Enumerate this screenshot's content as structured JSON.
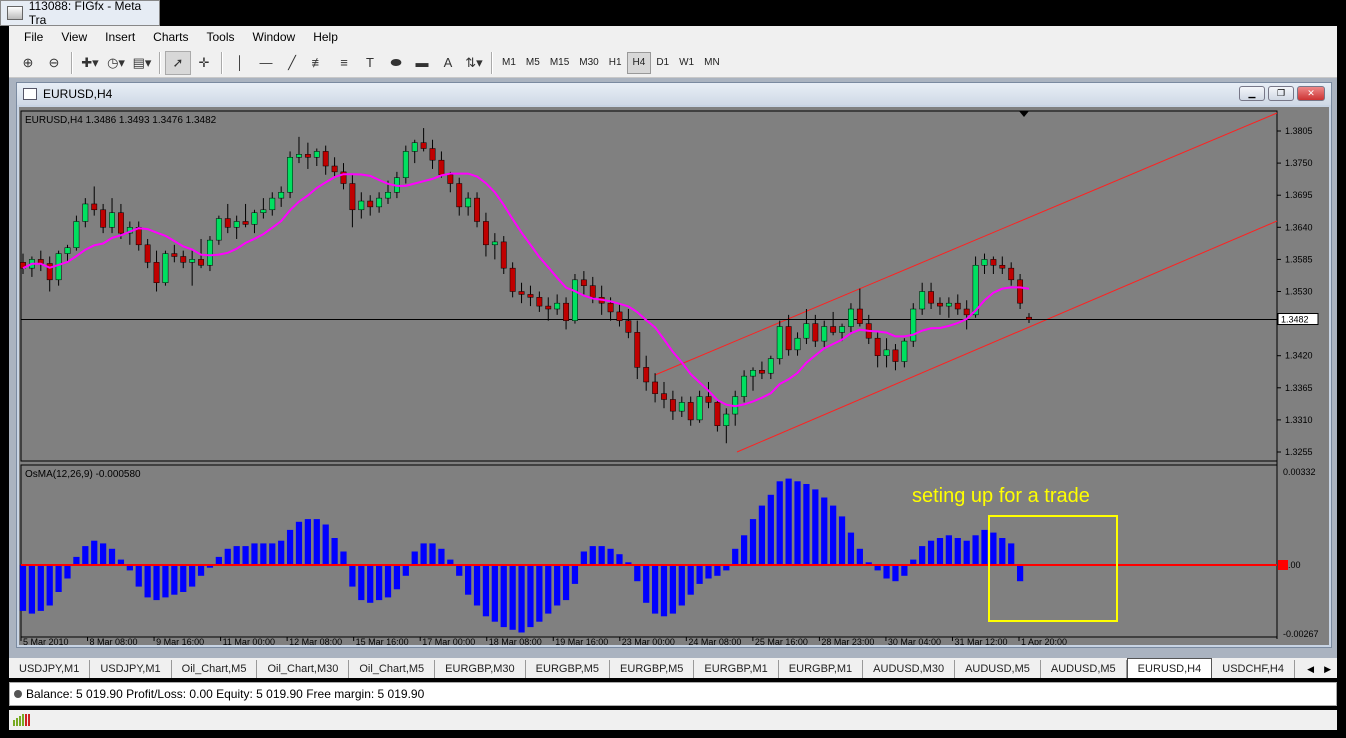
{
  "window": {
    "title": "113088: FIGfx - Meta Tra"
  },
  "menu": [
    "File",
    "View",
    "Insert",
    "Charts",
    "Tools",
    "Window",
    "Help"
  ],
  "toolbar": {
    "timeframes": [
      "M1",
      "M5",
      "M15",
      "M30",
      "H1",
      "H4",
      "D1",
      "W1",
      "MN"
    ],
    "active_timeframe": "H4"
  },
  "chart_window": {
    "title": "EURUSD,H4",
    "info": "EURUSD,H4  1.3486 1.3493 1.3476 1.3482",
    "current_price": "1.3482",
    "price_ticks": [
      "1.3805",
      "1.3750",
      "1.3695",
      "1.3640",
      "1.3585",
      "1.3530",
      "1.3420",
      "1.3365",
      "1.3310",
      "1.3255"
    ],
    "indicator_label": "OsMA(12,26,9) -0.000580",
    "indicator_ticks": [
      "0.00332",
      "0.00",
      "-0.00267"
    ],
    "annotation": "seting up for a trade",
    "time_labels": [
      "5 Mar 2010",
      "8 Mar 08:00",
      "9 Mar 16:00",
      "11 Mar 00:00",
      "12 Mar 08:00",
      "15 Mar 16:00",
      "17 Mar 00:00",
      "18 Mar 08:00",
      "19 Mar 16:00",
      "23 Mar 00:00",
      "24 Mar 08:00",
      "25 Mar 16:00",
      "28 Mar 23:00",
      "30 Mar 04:00",
      "31 Mar 12:00",
      "1 Apr 20:00"
    ]
  },
  "tabs": [
    "USDJPY,M1",
    "USDJPY,M1",
    "Oil_Chart,M5",
    "Oil_Chart,M30",
    "Oil_Chart,M5",
    "EURGBP,M30",
    "EURGBP,M5",
    "EURGBP,M5",
    "EURGBP,M1",
    "EURGBP,M1",
    "AUDUSD,M30",
    "AUDUSD,M5",
    "AUDUSD,M5",
    "EURUSD,H4",
    "USDCHF,H4"
  ],
  "active_tab": "EURUSD,H4",
  "terminal": {
    "text": "Balance: 5 019.90  Profit/Loss: 0.00  Equity: 5 019.90  Free margin: 5 019.90"
  },
  "colors": {
    "chart_bg": "#808080",
    "bull": "#00e060",
    "bear": "#c00000",
    "ma": "#ff00ff",
    "osma": "#0000ff",
    "channel": "#ff0000",
    "annotation": "#ffff00"
  },
  "chart_data": {
    "type": "candlestick",
    "symbol": "EURUSD",
    "timeframe": "H4",
    "ylim": [
      1.3255,
      1.3805
    ],
    "current": 1.3482,
    "candles": [
      [
        1.358,
        1.3595,
        1.356,
        1.357
      ],
      [
        1.357,
        1.359,
        1.3555,
        1.3585
      ],
      [
        1.3585,
        1.36,
        1.3565,
        1.3578
      ],
      [
        1.3578,
        1.359,
        1.353,
        1.355
      ],
      [
        1.355,
        1.36,
        1.354,
        1.3595
      ],
      [
        1.3595,
        1.361,
        1.358,
        1.3605
      ],
      [
        1.3605,
        1.366,
        1.36,
        1.365
      ],
      [
        1.365,
        1.369,
        1.364,
        1.368
      ],
      [
        1.368,
        1.371,
        1.366,
        1.367
      ],
      [
        1.367,
        1.368,
        1.363,
        1.364
      ],
      [
        1.364,
        1.369,
        1.363,
        1.3665
      ],
      [
        1.3665,
        1.368,
        1.362,
        1.363
      ],
      [
        1.363,
        1.365,
        1.361,
        1.364
      ],
      [
        1.364,
        1.365,
        1.36,
        1.361
      ],
      [
        1.361,
        1.362,
        1.357,
        1.358
      ],
      [
        1.358,
        1.36,
        1.353,
        1.3545
      ],
      [
        1.3545,
        1.36,
        1.354,
        1.3595
      ],
      [
        1.3595,
        1.361,
        1.358,
        1.359
      ],
      [
        1.359,
        1.36,
        1.357,
        1.358
      ],
      [
        1.358,
        1.36,
        1.354,
        1.3585
      ],
      [
        1.3585,
        1.362,
        1.357,
        1.3575
      ],
      [
        1.3575,
        1.3625,
        1.3565,
        1.3618
      ],
      [
        1.3618,
        1.366,
        1.361,
        1.3655
      ],
      [
        1.3655,
        1.368,
        1.363,
        1.364
      ],
      [
        1.364,
        1.366,
        1.362,
        1.365
      ],
      [
        1.365,
        1.368,
        1.364,
        1.3645
      ],
      [
        1.3645,
        1.367,
        1.363,
        1.3665
      ],
      [
        1.3665,
        1.369,
        1.3655,
        1.367
      ],
      [
        1.367,
        1.37,
        1.366,
        1.369
      ],
      [
        1.369,
        1.371,
        1.3675,
        1.37
      ],
      [
        1.37,
        1.377,
        1.369,
        1.376
      ],
      [
        1.376,
        1.3795,
        1.375,
        1.3765
      ],
      [
        1.3765,
        1.3785,
        1.374,
        1.376
      ],
      [
        1.376,
        1.3775,
        1.3745,
        1.377
      ],
      [
        1.377,
        1.378,
        1.373,
        1.3745
      ],
      [
        1.3745,
        1.376,
        1.3725,
        1.3735
      ],
      [
        1.3735,
        1.375,
        1.3705,
        1.3715
      ],
      [
        1.3715,
        1.373,
        1.364,
        1.367
      ],
      [
        1.367,
        1.37,
        1.3655,
        1.3685
      ],
      [
        1.3685,
        1.3695,
        1.366,
        1.3675
      ],
      [
        1.3675,
        1.37,
        1.3665,
        1.369
      ],
      [
        1.369,
        1.372,
        1.368,
        1.37
      ],
      [
        1.37,
        1.3735,
        1.369,
        1.3725
      ],
      [
        1.3725,
        1.378,
        1.3715,
        1.377
      ],
      [
        1.377,
        1.379,
        1.375,
        1.3785
      ],
      [
        1.3785,
        1.381,
        1.377,
        1.3775
      ],
      [
        1.3775,
        1.379,
        1.374,
        1.3755
      ],
      [
        1.3755,
        1.377,
        1.3725,
        1.373
      ],
      [
        1.373,
        1.3735,
        1.37,
        1.3715
      ],
      [
        1.3715,
        1.3725,
        1.366,
        1.3675
      ],
      [
        1.3675,
        1.37,
        1.366,
        1.369
      ],
      [
        1.369,
        1.37,
        1.364,
        1.365
      ],
      [
        1.365,
        1.3665,
        1.359,
        1.361
      ],
      [
        1.361,
        1.363,
        1.3585,
        1.3615
      ],
      [
        1.3615,
        1.3625,
        1.356,
        1.357
      ],
      [
        1.357,
        1.358,
        1.352,
        1.353
      ],
      [
        1.353,
        1.3545,
        1.351,
        1.3525
      ],
      [
        1.3525,
        1.354,
        1.3505,
        1.352
      ],
      [
        1.352,
        1.353,
        1.3495,
        1.3505
      ],
      [
        1.3505,
        1.352,
        1.348,
        1.35
      ],
      [
        1.35,
        1.3525,
        1.349,
        1.351
      ],
      [
        1.351,
        1.352,
        1.3465,
        1.348
      ],
      [
        1.348,
        1.356,
        1.3475,
        1.355
      ],
      [
        1.355,
        1.3565,
        1.3525,
        1.354
      ],
      [
        1.354,
        1.3555,
        1.351,
        1.352
      ],
      [
        1.352,
        1.354,
        1.349,
        1.351
      ],
      [
        1.351,
        1.352,
        1.348,
        1.3495
      ],
      [
        1.3495,
        1.351,
        1.347,
        1.348
      ],
      [
        1.348,
        1.35,
        1.345,
        1.346
      ],
      [
        1.346,
        1.348,
        1.338,
        1.34
      ],
      [
        1.34,
        1.342,
        1.336,
        1.3375
      ],
      [
        1.3375,
        1.339,
        1.334,
        1.3355
      ],
      [
        1.3355,
        1.3375,
        1.333,
        1.3345
      ],
      [
        1.3345,
        1.336,
        1.331,
        1.3325
      ],
      [
        1.3325,
        1.335,
        1.3315,
        1.334
      ],
      [
        1.334,
        1.335,
        1.33,
        1.331
      ],
      [
        1.331,
        1.336,
        1.3305,
        1.335
      ],
      [
        1.335,
        1.3375,
        1.333,
        1.334
      ],
      [
        1.334,
        1.3345,
        1.329,
        1.33
      ],
      [
        1.33,
        1.333,
        1.327,
        1.332
      ],
      [
        1.332,
        1.336,
        1.33,
        1.335
      ],
      [
        1.335,
        1.3395,
        1.334,
        1.3385
      ],
      [
        1.3385,
        1.34,
        1.336,
        1.3395
      ],
      [
        1.3395,
        1.341,
        1.338,
        1.339
      ],
      [
        1.339,
        1.342,
        1.338,
        1.3415
      ],
      [
        1.3415,
        1.348,
        1.3405,
        1.347
      ],
      [
        1.347,
        1.349,
        1.342,
        1.343
      ],
      [
        1.343,
        1.346,
        1.342,
        1.345
      ],
      [
        1.345,
        1.35,
        1.344,
        1.3475
      ],
      [
        1.3475,
        1.349,
        1.3435,
        1.3445
      ],
      [
        1.3445,
        1.348,
        1.3435,
        1.347
      ],
      [
        1.347,
        1.3495,
        1.3455,
        1.346
      ],
      [
        1.346,
        1.3475,
        1.3445,
        1.347
      ],
      [
        1.347,
        1.351,
        1.346,
        1.35
      ],
      [
        1.35,
        1.3535,
        1.347,
        1.3475
      ],
      [
        1.3475,
        1.349,
        1.344,
        1.345
      ],
      [
        1.345,
        1.346,
        1.34,
        1.342
      ],
      [
        1.342,
        1.345,
        1.34,
        1.343
      ],
      [
        1.343,
        1.344,
        1.3395,
        1.341
      ],
      [
        1.341,
        1.345,
        1.34,
        1.3445
      ],
      [
        1.3445,
        1.351,
        1.3435,
        1.35
      ],
      [
        1.35,
        1.3545,
        1.349,
        1.353
      ],
      [
        1.353,
        1.3545,
        1.35,
        1.351
      ],
      [
        1.351,
        1.352,
        1.349,
        1.3505
      ],
      [
        1.3505,
        1.352,
        1.3485,
        1.351
      ],
      [
        1.351,
        1.3525,
        1.349,
        1.35
      ],
      [
        1.35,
        1.3515,
        1.3465,
        1.349
      ],
      [
        1.349,
        1.359,
        1.3485,
        1.3575
      ],
      [
        1.3575,
        1.3595,
        1.356,
        1.3585
      ],
      [
        1.3585,
        1.359,
        1.356,
        1.3575
      ],
      [
        1.3575,
        1.359,
        1.356,
        1.357
      ],
      [
        1.357,
        1.358,
        1.354,
        1.355
      ],
      [
        1.355,
        1.356,
        1.35,
        1.351
      ],
      [
        1.3486,
        1.3493,
        1.3476,
        1.3482
      ]
    ],
    "osma": [
      -0.0017,
      -0.0018,
      -0.0017,
      -0.0015,
      -0.001,
      -0.0005,
      0.0003,
      0.0007,
      0.0009,
      0.0008,
      0.0006,
      0.0002,
      -0.0002,
      -0.0008,
      -0.0012,
      -0.0013,
      -0.0012,
      -0.0011,
      -0.001,
      -0.0008,
      -0.0004,
      -0.0001,
      0.0003,
      0.0006,
      0.0007,
      0.0007,
      0.0008,
      0.0008,
      0.0008,
      0.0009,
      0.0013,
      0.0016,
      0.0017,
      0.0017,
      0.0015,
      0.001,
      0.0005,
      -0.0008,
      -0.0013,
      -0.0014,
      -0.0013,
      -0.0012,
      -0.0009,
      -0.0004,
      0.0005,
      0.0008,
      0.0008,
      0.0006,
      0.0002,
      -0.0004,
      -0.0011,
      -0.0015,
      -0.0019,
      -0.0021,
      -0.0023,
      -0.0024,
      -0.0025,
      -0.0023,
      -0.0021,
      -0.0018,
      -0.0015,
      -0.0013,
      -0.0007,
      0.0005,
      0.0007,
      0.0007,
      0.0006,
      0.0004,
      0.0001,
      -0.0006,
      -0.0014,
      -0.0018,
      -0.0019,
      -0.0018,
      -0.0015,
      -0.0011,
      -0.0007,
      -0.0005,
      -0.0004,
      -0.0002,
      0.0006,
      0.0011,
      0.0017,
      0.0022,
      0.0026,
      0.0031,
      0.0032,
      0.0031,
      0.003,
      0.0028,
      0.0025,
      0.0022,
      0.0018,
      0.0012,
      0.0006,
      0.0001,
      -0.0002,
      -0.0005,
      -0.0006,
      -0.0004,
      0.0002,
      0.0007,
      0.0009,
      0.001,
      0.0011,
      0.001,
      0.0009,
      0.0011,
      0.0013,
      0.0012,
      0.001,
      0.0008,
      -0.0006
    ]
  }
}
